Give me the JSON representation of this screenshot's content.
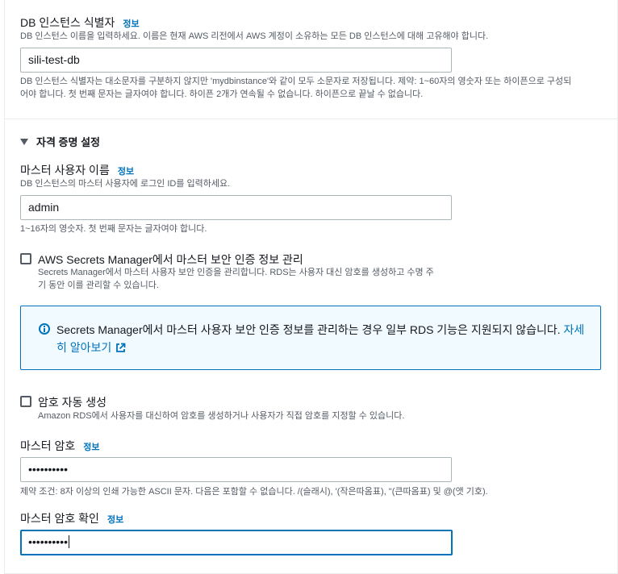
{
  "db_identifier": {
    "label": "DB 인스턴스 식별자",
    "info": "정보",
    "description": "DB 인스턴스 이름을 입력하세요. 이름은 현재 AWS 리전에서 AWS 계정이 소유하는 모든 DB 인스턴스에 대해 고유해야 합니다.",
    "value": "sili-test-db",
    "constraint_line1": "DB 인스턴스 식별자는 대소문자를 구분하지 않지만 'mydbinstance'와 같이 모두 소문자로 저장됩니다. 제약: 1~60자의 영숫자 또는 하이픈으로 구성되",
    "constraint_line2": "어야 합니다. 첫 번째 문자는 글자여야 합니다. 하이픈 2개가 연속될 수 없습니다. 하이픈으로 끝날 수 없습니다."
  },
  "credentials_section": {
    "title": "자격 증명 설정",
    "expanded": true
  },
  "master_username": {
    "label": "마스터 사용자 이름",
    "info": "정보",
    "description": "DB 인스턴스의 마스터 사용자에 로그인 ID를 입력하세요.",
    "value": "admin",
    "constraint": "1~16자의 영숫자. 첫 번째 문자는 글자여야 합니다."
  },
  "secrets_manager": {
    "checked": false,
    "label": "AWS Secrets Manager에서 마스터 보안 인증 정보 관리",
    "description_line1": "Secrets Manager에서 마스터 사용자 보안 인증을 관리합니다. RDS는 사용자 대신 암호를 생성하고 수명 주",
    "description_line2": "기 동안 이를 관리할 수 있습니다."
  },
  "alert": {
    "icon": "info-circle-icon",
    "text": "Secrets Manager에서 마스터 사용자 보안 인증 정보를 관리하는 경우 일부 RDS 기능은 지원되지 않습니다. ",
    "link_text": "자세히 알아보기",
    "link_icon": "external-link-icon"
  },
  "auto_password": {
    "checked": false,
    "label": "암호 자동 생성",
    "description": "Amazon RDS에서 사용자를 대신하여 암호를 생성하거나 사용자가 직접 암호를 지정할 수 있습니다."
  },
  "master_password": {
    "label": "마스터 암호",
    "info": "정보",
    "value": "••••••••••",
    "constraint": "제약 조건: 8자 이상의 인쇄 가능한 ASCII 문자. 다음은 포함할 수 없습니다. /(슬래시), '(작은따옴표), \"(큰따옴표) 및 @(앳 기호)."
  },
  "confirm_password": {
    "label": "마스터 암호 확인",
    "info": "정보",
    "value": "••••••••••"
  },
  "colors": {
    "link": "#0073bb",
    "text": "#16191f",
    "muted": "#545b64",
    "border": "#aab7b8",
    "alert_bg": "#f1faff"
  }
}
